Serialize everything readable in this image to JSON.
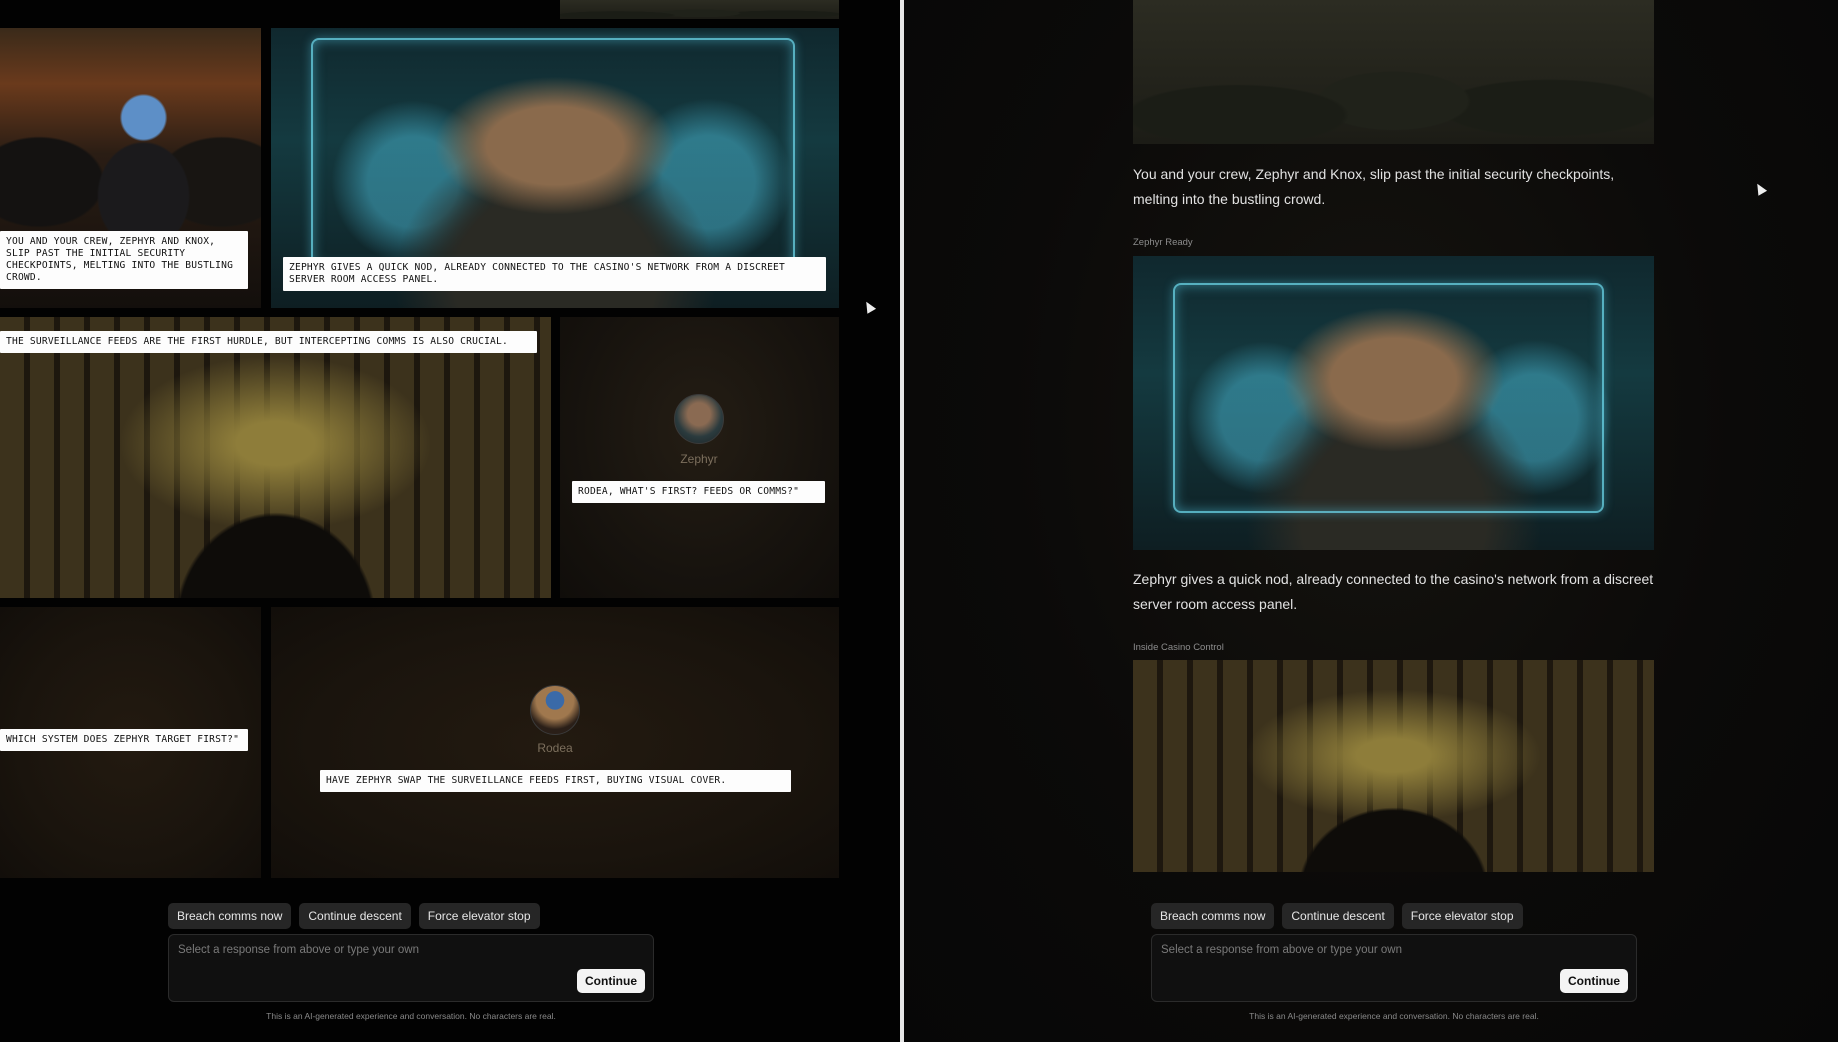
{
  "comic": {
    "panels": {
      "crowd_caption": "You and your crew, Zephyr and Knox, slip past the initial security checkpoints, melting into the bustling crowd.",
      "zephyr_caption": "Zephyr gives a quick nod, already connected to the casino's network from a discreet server room access panel.",
      "control_caption": "The surveillance feeds are the first hurdle, but intercepting comms is also crucial.",
      "zephyr_speaker": "Zephyr",
      "zephyr_speech": "Rodea, what's first? Feeds or comms?\"",
      "question_caption": "Which system does Zephyr target first?\"",
      "rodea_speaker": "Rodea",
      "rodea_speech": "Have Zephyr swap the surveillance feeds first, buying visual cover."
    }
  },
  "feed": {
    "text_1": "You and your crew, Zephyr and Knox, slip past the initial security checkpoints, melting into the bustling crowd.",
    "label_1": "Zephyr Ready",
    "text_2": "Zephyr gives a quick nod, already connected to the casino's network from a discreet server room access panel.",
    "label_2": "Inside Casino Control"
  },
  "chat": {
    "suggestions": [
      "Breach comms now",
      "Continue descent",
      "Force elevator stop"
    ],
    "placeholder": "Select a response from above or type your own",
    "continue_label": "Continue",
    "disclaimer": "This is an AI-generated experience and conversation. No characters are real."
  }
}
